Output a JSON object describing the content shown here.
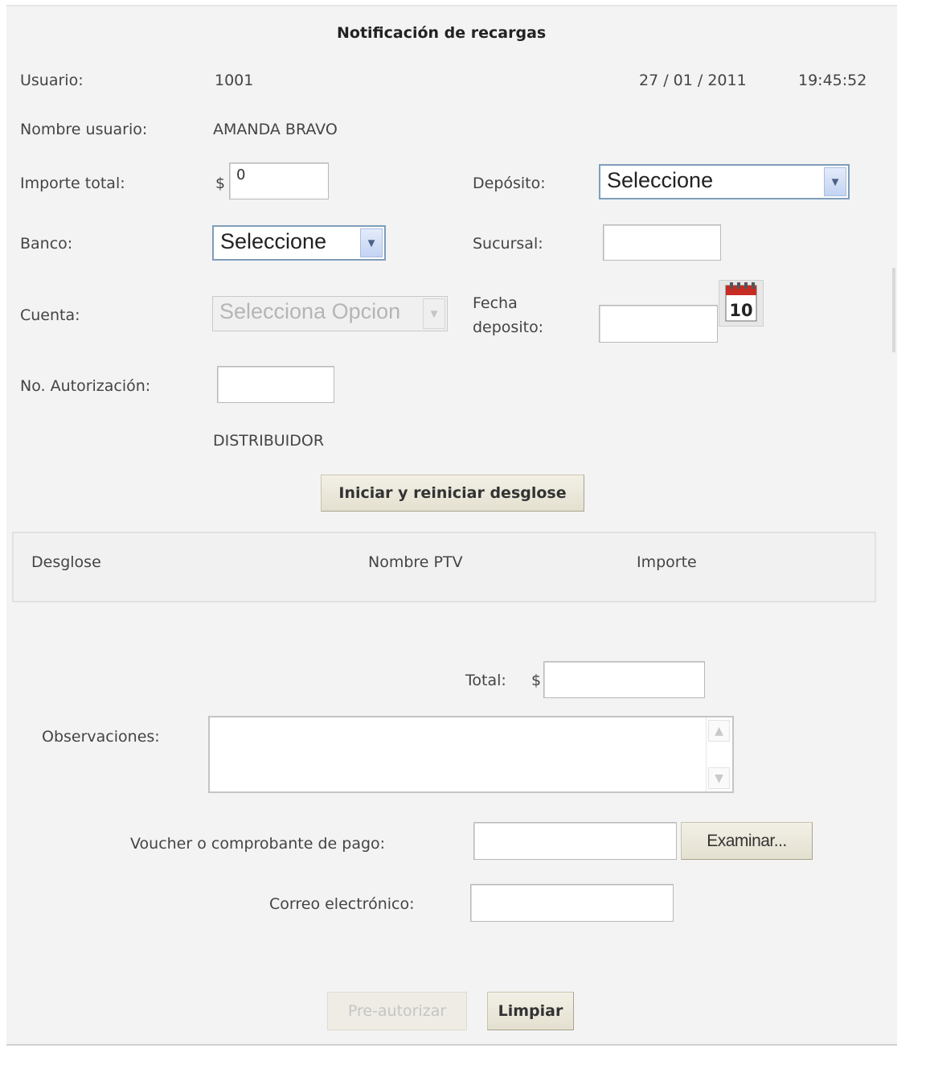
{
  "form": {
    "title": "Notificación de recargas",
    "usuario_label": "Usuario:",
    "usuario_value": "1001",
    "date": "27 / 01 / 2011",
    "time": "19:45:52",
    "nombre_label": "Nombre usuario:",
    "nombre_value": "AMANDA BRAVO",
    "importe_label": "Importe total:",
    "importe_currency": "$",
    "importe_value": "0",
    "deposito_label": "Depósito:",
    "deposito_value": "Seleccione",
    "banco_label": "Banco:",
    "banco_value": "Seleccione",
    "sucursal_label": "Sucursal:",
    "sucursal_value": "",
    "cuenta_label": "Cuenta:",
    "cuenta_value": "Selecciona Opcion",
    "fecha_label_1": "Fecha",
    "fecha_label_2": "deposito:",
    "fecha_value": "",
    "calendar_day": "10",
    "autorizacion_label": "No. Autorización:",
    "autorizacion_value": "",
    "distribuidor_text": "DISTRIBUIDOR",
    "desglose_button": "Iniciar y reiniciar desglose"
  },
  "desglose_table": {
    "columns": [
      "Desglose",
      "Nombre PTV",
      "Importe"
    ]
  },
  "footer": {
    "total_label": "Total:",
    "total_currency": "$",
    "total_value": "",
    "observaciones_label": "Observaciones:",
    "observaciones_value": "",
    "voucher_label": "Voucher o comprobante de pago:",
    "voucher_value": "",
    "examinar_button": "Examinar...",
    "correo_label": "Correo electrónico:",
    "correo_value": "",
    "preautorizar_button": "Pre-autorizar",
    "limpiar_button": "Limpiar"
  },
  "icons": {
    "select_arrow": "chevron-down-icon",
    "calendar": "calendar-icon",
    "scroll_up": "arrow-up-icon",
    "scroll_down": "arrow-down-icon"
  },
  "colors": {
    "panel_bg": "#f3f3f3",
    "select_border": "#7f9db9",
    "button_bg": "#e8e4d4",
    "calendar_red": "#c62b24"
  }
}
